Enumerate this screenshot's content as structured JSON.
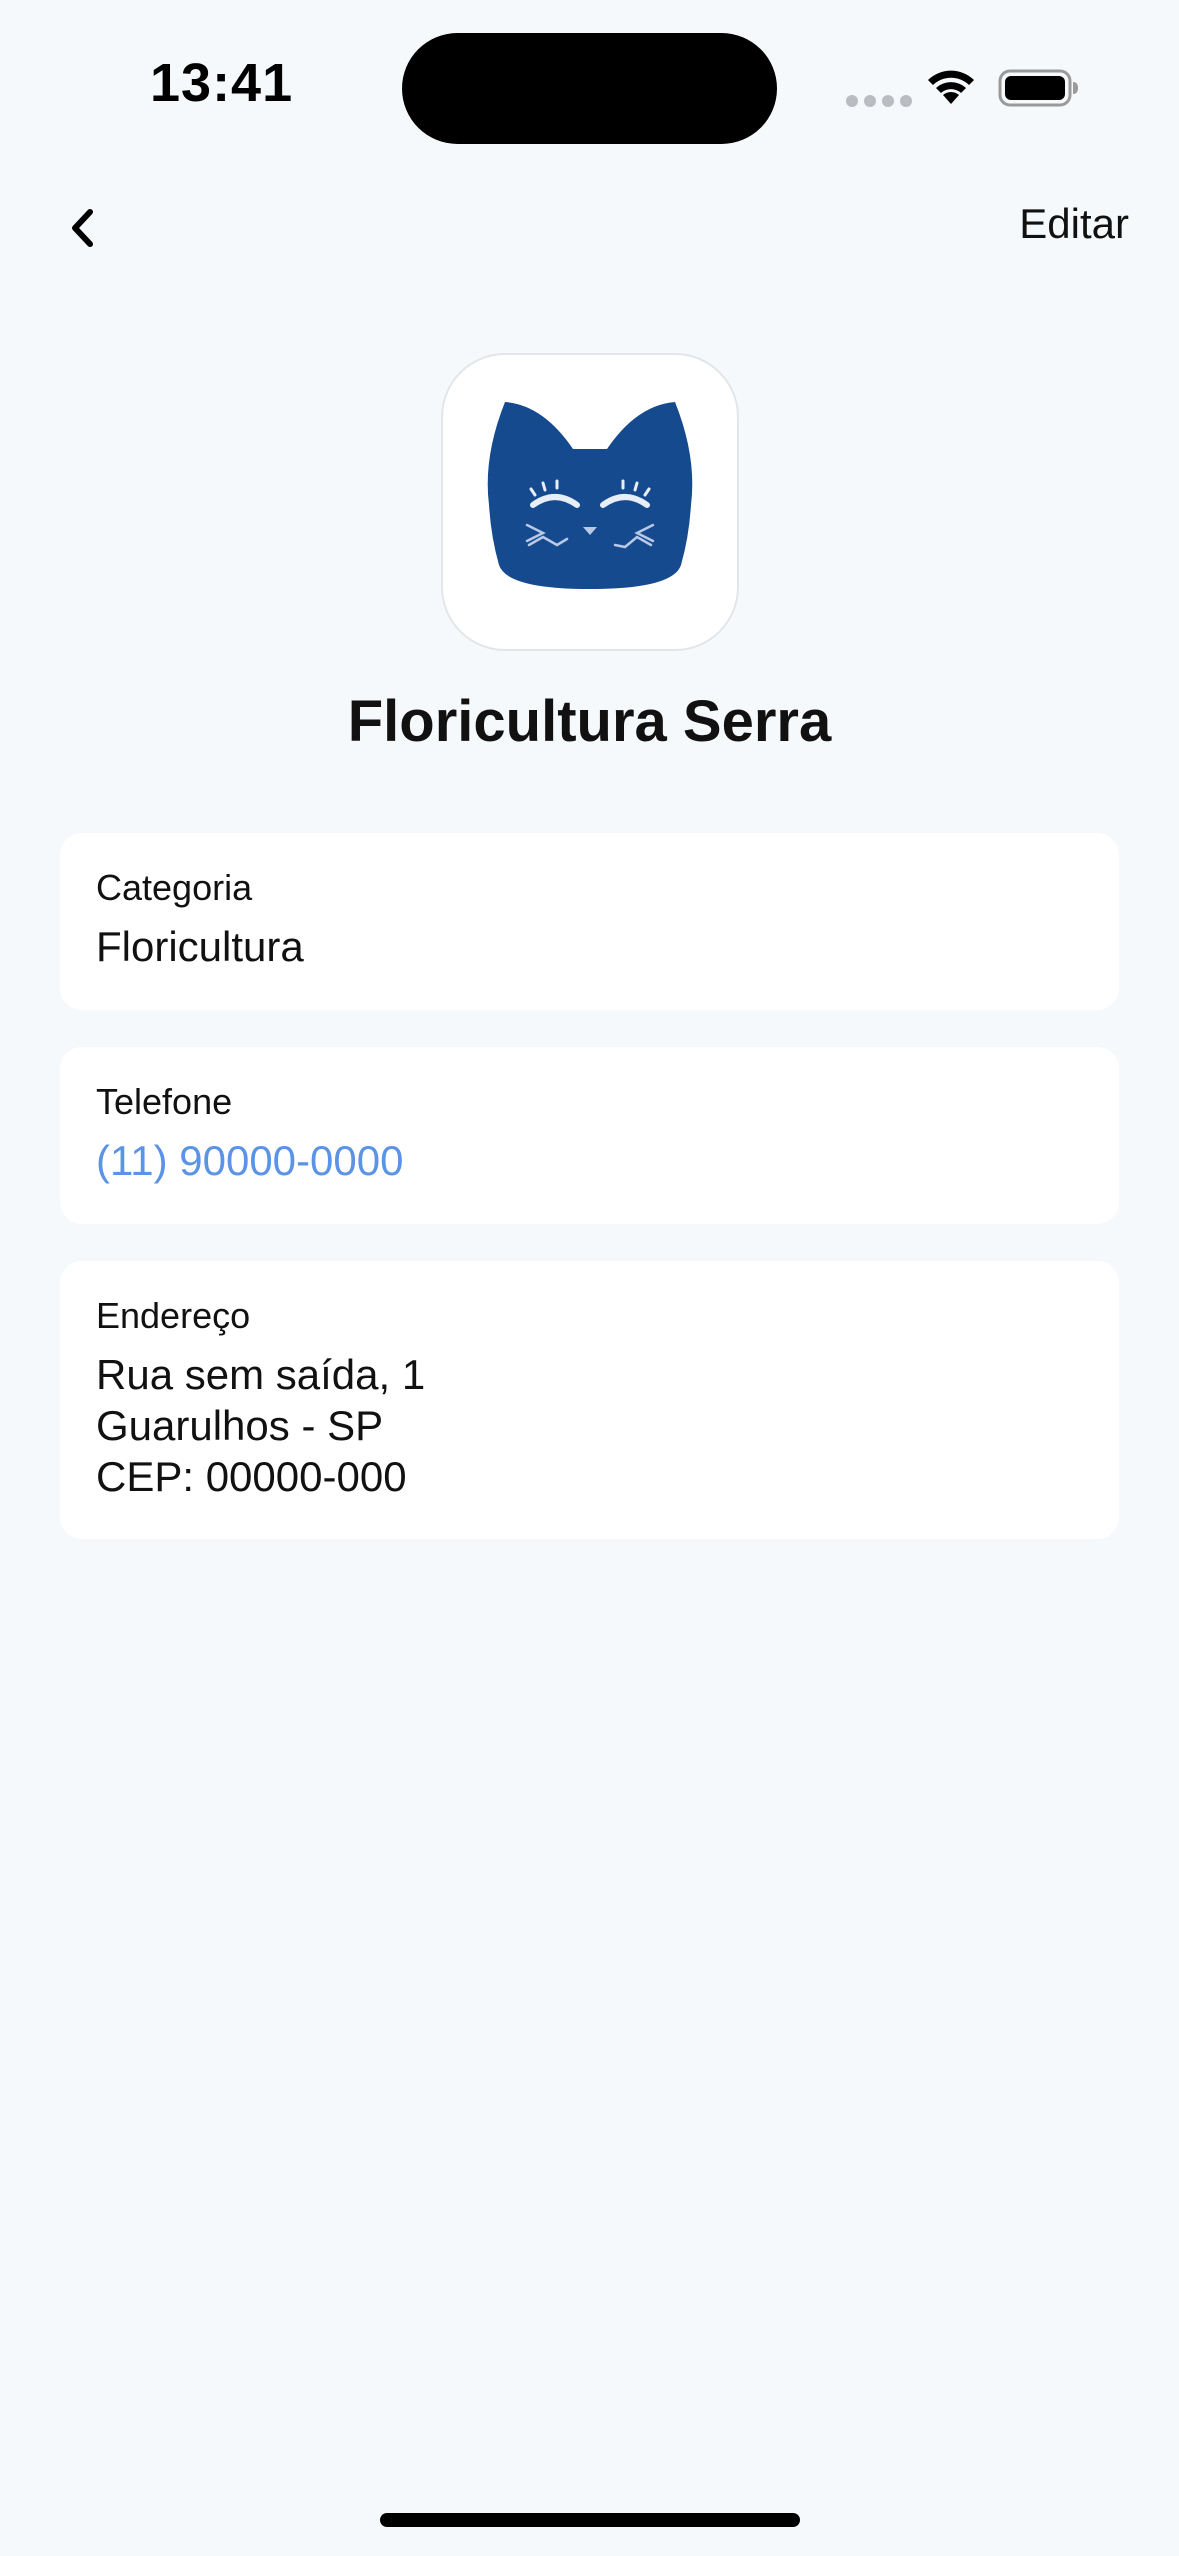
{
  "status_bar": {
    "time": "13:41",
    "icons": [
      "signal-icon",
      "wifi-icon",
      "battery-icon"
    ]
  },
  "nav": {
    "back_icon": "chevron-left-icon",
    "edit_label": "Editar"
  },
  "store": {
    "logo_icon": "cat-logo-icon",
    "name": "Floricultura Serra"
  },
  "details": {
    "category": {
      "label": "Categoria",
      "value": "Floricultura"
    },
    "phone": {
      "label": "Telefone",
      "value": "(11) 90000-0000"
    },
    "address": {
      "label": "Endereço",
      "line1": "Rua sem saída, 1",
      "line2": "Guarulhos - SP",
      "line3": "CEP: 00000-000"
    }
  },
  "colors": {
    "background": "#f6f9fb",
    "card": "#ffffff",
    "link": "#5b93e6",
    "logo": "#164a8f"
  }
}
